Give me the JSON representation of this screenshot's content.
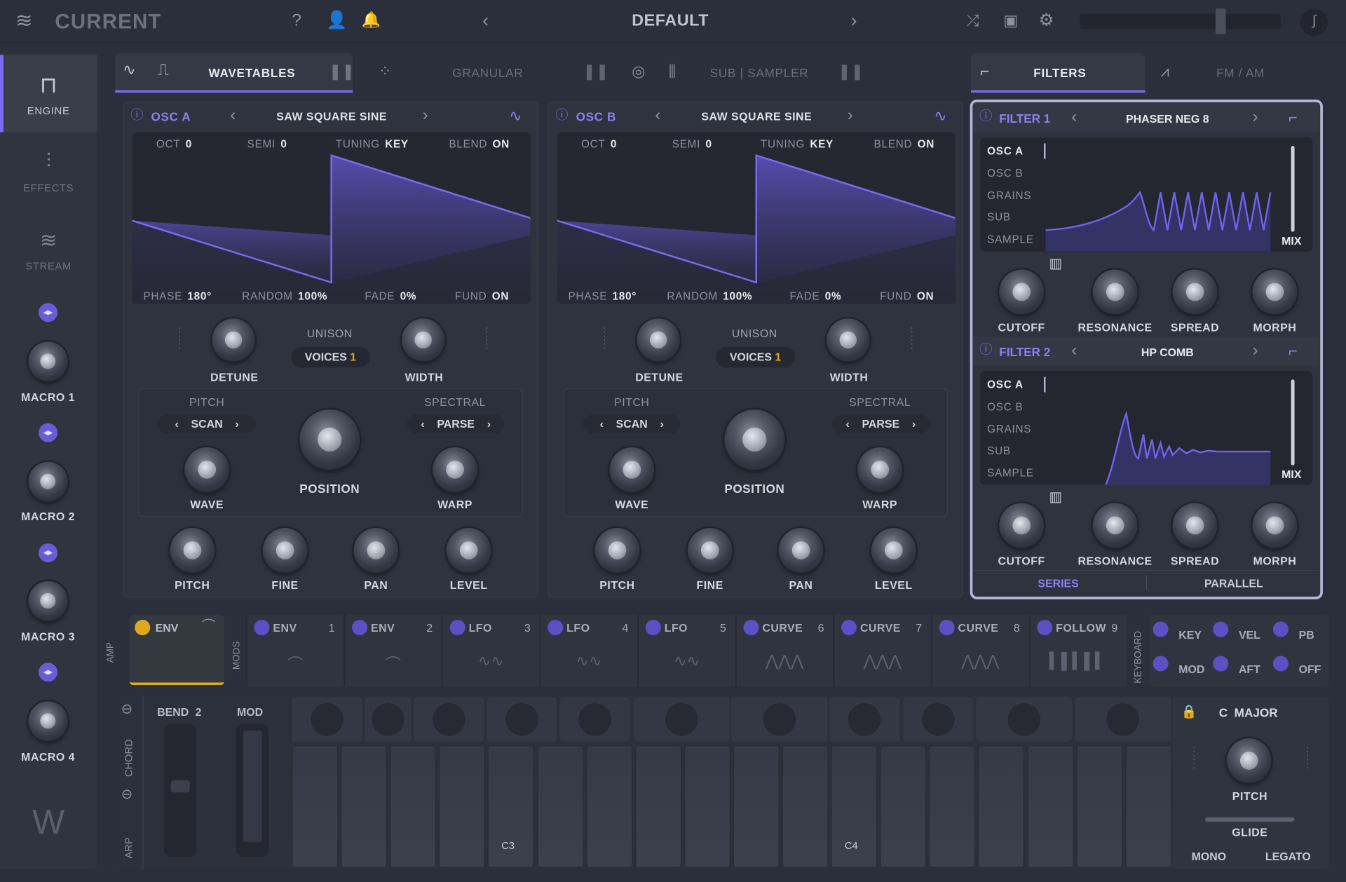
{
  "header": {
    "app_name": "CURRENT",
    "preset": "DEFAULT"
  },
  "sidebar": {
    "items": [
      {
        "label": "ENGINE"
      },
      {
        "label": "EFFECTS"
      },
      {
        "label": "STREAM"
      }
    ],
    "macros": [
      "MACRO 1",
      "MACRO 2",
      "MACRO 3",
      "MACRO 4"
    ]
  },
  "tabs": {
    "wavetables": "WAVETABLES",
    "granular": "GRANULAR",
    "sub_sampler": "SUB | SAMPLER",
    "filters": "FILTERS",
    "fm_am": "FM / AM"
  },
  "osc": [
    {
      "name": "OSC A",
      "preset": "SAW SQUARE SINE",
      "oct_label": "OCT",
      "oct": "0",
      "semi_label": "SEMI",
      "semi": "0",
      "tuning_label": "TUNING",
      "tuning": "KEY",
      "blend_label": "BLEND",
      "blend": "ON",
      "phase_label": "PHASE",
      "phase": "180°",
      "random_label": "RANDOM",
      "random": "100%",
      "fade_label": "FADE",
      "fade": "0%",
      "fund_label": "FUND",
      "fund": "ON",
      "detune": "DETUNE",
      "unison": "UNISON",
      "voices_label": "VOICES",
      "voices": "1",
      "width": "WIDTH",
      "pitch_group": "PITCH",
      "scan": "SCAN",
      "spectral_group": "SPECTRAL",
      "parse": "PARSE",
      "wave": "WAVE",
      "position": "POSITION",
      "warp": "WARP",
      "pitch": "PITCH",
      "fine": "FINE",
      "pan": "PAN",
      "level": "LEVEL"
    },
    {
      "name": "OSC B",
      "preset": "SAW SQUARE SINE",
      "oct_label": "OCT",
      "oct": "0",
      "semi_label": "SEMI",
      "semi": "0",
      "tuning_label": "TUNING",
      "tuning": "KEY",
      "blend_label": "BLEND",
      "blend": "ON",
      "phase_label": "PHASE",
      "phase": "180°",
      "random_label": "RANDOM",
      "random": "100%",
      "fade_label": "FADE",
      "fade": "0%",
      "fund_label": "FUND",
      "fund": "ON",
      "detune": "DETUNE",
      "unison": "UNISON",
      "voices_label": "VOICES",
      "voices": "1",
      "width": "WIDTH",
      "pitch_group": "PITCH",
      "scan": "SCAN",
      "spectral_group": "SPECTRAL",
      "parse": "PARSE",
      "wave": "WAVE",
      "position": "POSITION",
      "warp": "WARP",
      "pitch": "PITCH",
      "fine": "FINE",
      "pan": "PAN",
      "level": "LEVEL"
    }
  ],
  "filters": [
    {
      "name": "FILTER 1",
      "type": "PHASER NEG 8",
      "sources": [
        "OSC A",
        "OSC B",
        "GRAINS",
        "SUB",
        "SAMPLE"
      ],
      "mix": "MIX",
      "cutoff": "CUTOFF",
      "resonance": "RESONANCE",
      "spread": "SPREAD",
      "morph": "MORPH"
    },
    {
      "name": "FILTER 2",
      "type": "HP COMB",
      "sources": [
        "OSC A",
        "OSC B",
        "GRAINS",
        "SUB",
        "SAMPLE"
      ],
      "mix": "MIX",
      "cutoff": "CUTOFF",
      "resonance": "RESONANCE",
      "spread": "SPREAD",
      "morph": "MORPH"
    }
  ],
  "routing": {
    "series": "SERIES",
    "parallel": "PARALLEL"
  },
  "mods": {
    "amp": "AMP",
    "amp_env": "ENV",
    "mods_label": "MODS",
    "keyboard_label": "KEYBOARD",
    "slots": [
      {
        "label": "ENV",
        "num": "1"
      },
      {
        "label": "ENV",
        "num": "2"
      },
      {
        "label": "LFO",
        "num": "3"
      },
      {
        "label": "LFO",
        "num": "4"
      },
      {
        "label": "LFO",
        "num": "5"
      },
      {
        "label": "CURVE",
        "num": "6"
      },
      {
        "label": "CURVE",
        "num": "7"
      },
      {
        "label": "CURVE",
        "num": "8"
      },
      {
        "label": "FOLLOW",
        "num": "9"
      }
    ],
    "kb": [
      "KEY",
      "VEL",
      "PB",
      "MOD",
      "AFT",
      "OFF"
    ]
  },
  "keyboard": {
    "bend_label": "BEND",
    "bend": "2",
    "mod": "MOD",
    "chord": "CHORD",
    "arp": "ARP",
    "c3": "C3",
    "c4": "C4",
    "scale": "C  MAJOR",
    "pitch": "PITCH",
    "glide": "GLIDE",
    "mono": "MONO",
    "legato": "LEGATO"
  },
  "colors": {
    "accent": "#7a6cf0",
    "bg": "#2b2f3b",
    "panel": "#30343f",
    "amp_env": "#e0a81c"
  }
}
